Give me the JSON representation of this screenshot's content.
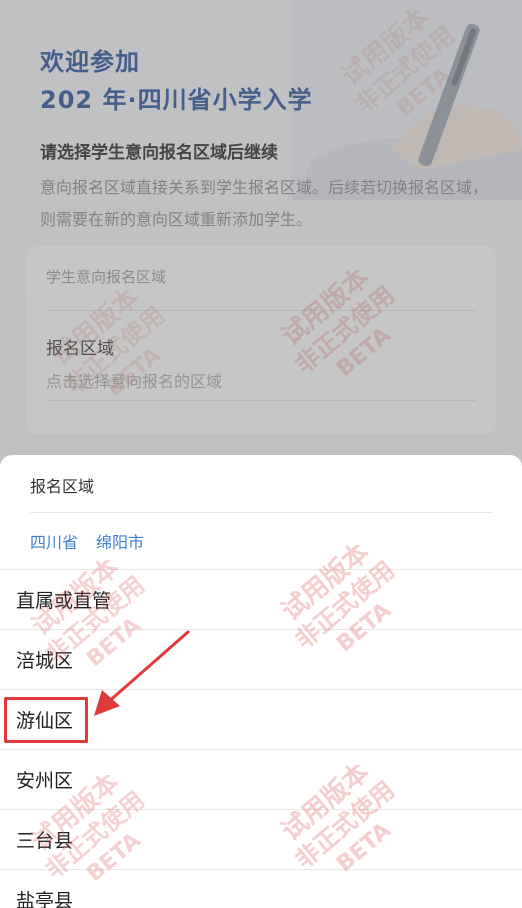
{
  "header": {
    "welcome": "欢迎参加",
    "year_title": "202  年·四川省小学入学",
    "subtitle": "请选择学生意向报名区域后继续",
    "description": "意向报名区域直接关系到学生报名区域。后续若切换报名区域，则需要在新的意向区域重新添加学生。"
  },
  "card": {
    "header": "学生意向报名区域",
    "field_label": "报名区域",
    "field_placeholder": "点击选择意向报名的区域"
  },
  "sheet": {
    "title": "报名区域",
    "breadcrumbs": [
      "四川省",
      "绵阳市"
    ],
    "options": [
      "直属或直管",
      "涪城区",
      "游仙区",
      "安州区",
      "三台县",
      "盐亭县"
    ]
  },
  "watermark": {
    "line1": "试用版本",
    "line2": "非正式使用",
    "line3": "BETA"
  },
  "colors": {
    "title_blue": "#1f4f9c",
    "link_blue": "#3a7fd0",
    "annotation_red": "#e03a3a"
  }
}
